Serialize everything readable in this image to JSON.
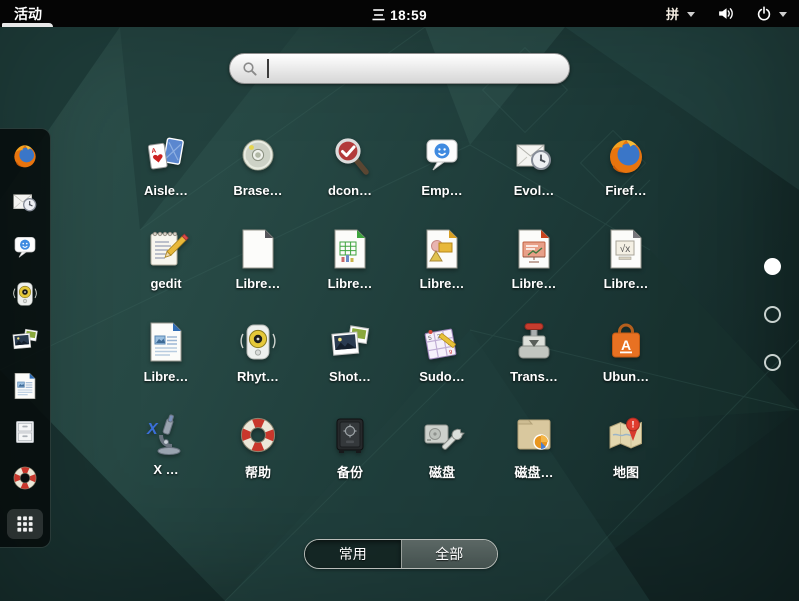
{
  "theme": {
    "topbar_bg": "#050505",
    "wallpaper_teal_light": "#2e524d",
    "wallpaper_teal_dark": "#122625",
    "dash_bg": "rgba(6,12,12,0.86)",
    "search_field_bg": "#e9e9e9",
    "label_color": "#ffffff"
  },
  "topbar": {
    "activities_label": "活动",
    "clock": "三 18:59",
    "input_method_label": "拼",
    "status_icons": [
      "input-method",
      "chevron-down",
      "volume",
      "power",
      "chevron-down"
    ]
  },
  "search": {
    "value": "",
    "placeholder": ""
  },
  "dash": {
    "items": [
      {
        "name": "firefox",
        "icon": "firefox"
      },
      {
        "name": "evolution",
        "icon": "evolution"
      },
      {
        "name": "empathy",
        "icon": "empathy"
      },
      {
        "name": "rhythmbox",
        "icon": "rhythmbox"
      },
      {
        "name": "shotwell",
        "icon": "shotwell"
      },
      {
        "name": "libreoffice-writer",
        "icon": "libreoffice-writer"
      },
      {
        "name": "files",
        "icon": "files"
      },
      {
        "name": "help",
        "icon": "help"
      }
    ],
    "show_apps": {
      "name": "show-applications",
      "icon": "show-apps",
      "active": true
    }
  },
  "apps": {
    "items": [
      {
        "label": "Aisle…",
        "icon": "aisleriot"
      },
      {
        "label": "Brase…",
        "icon": "brasero"
      },
      {
        "label": "dcon…",
        "icon": "dconf-editor"
      },
      {
        "label": "Emp…",
        "icon": "empathy"
      },
      {
        "label": "Evol…",
        "icon": "evolution"
      },
      {
        "label": "Firef…",
        "icon": "firefox"
      },
      {
        "label": "gedit",
        "icon": "gedit"
      },
      {
        "label": "Libre…",
        "icon": "libreoffice-start"
      },
      {
        "label": "Libre…",
        "icon": "libreoffice-calc"
      },
      {
        "label": "Libre…",
        "icon": "libreoffice-draw"
      },
      {
        "label": "Libre…",
        "icon": "libreoffice-impress"
      },
      {
        "label": "Libre…",
        "icon": "libreoffice-math"
      },
      {
        "label": "Libre…",
        "icon": "libreoffice-writer"
      },
      {
        "label": "Rhyt…",
        "icon": "rhythmbox"
      },
      {
        "label": "Shot…",
        "icon": "shotwell"
      },
      {
        "label": "Sudo…",
        "icon": "sudoku"
      },
      {
        "label": "Trans…",
        "icon": "transmission"
      },
      {
        "label": "Ubun…",
        "icon": "ubuntu-software"
      },
      {
        "label": "X …",
        "icon": "xdiagnose"
      },
      {
        "label": "帮助",
        "icon": "help"
      },
      {
        "label": "备份",
        "icon": "backups"
      },
      {
        "label": "磁盘",
        "icon": "disks"
      },
      {
        "label": "磁盘…",
        "icon": "disk-usage-analyzer"
      },
      {
        "label": "地图",
        "icon": "maps"
      }
    ]
  },
  "pager": {
    "count": 3,
    "active_index": 0
  },
  "view_toggle": {
    "options": [
      {
        "label": "常用",
        "selected": true
      },
      {
        "label": "全部",
        "selected": false
      }
    ]
  }
}
